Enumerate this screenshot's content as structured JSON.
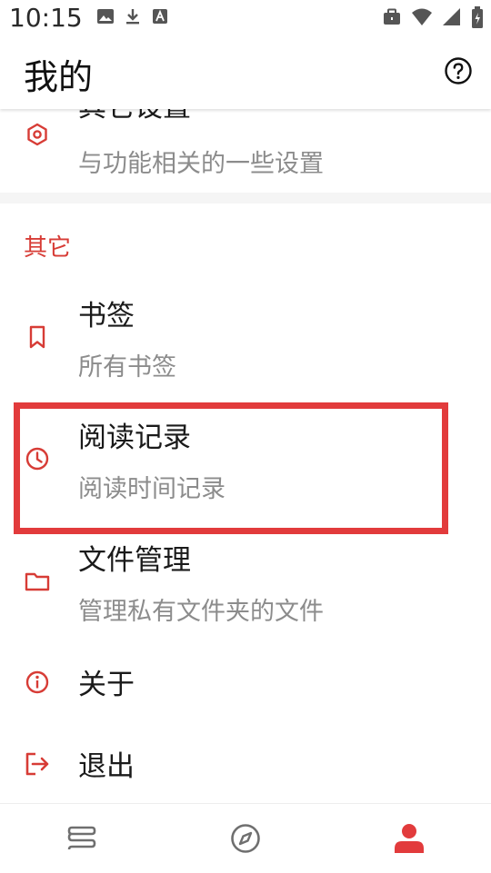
{
  "status_bar": {
    "time": "10:15",
    "icons_left": [
      "image-icon",
      "download-icon",
      "a-icon"
    ],
    "icons_right": [
      "briefcase-icon",
      "wifi-icon",
      "signal-icon",
      "battery-icon"
    ]
  },
  "app_bar": {
    "title": "我的",
    "help_icon": "help-circle-icon"
  },
  "items": {
    "other_settings": {
      "title": "其它设置",
      "subtitle": "与功能相关的一些设置",
      "icon": "settings-icon"
    },
    "bookmarks": {
      "title": "书签",
      "subtitle": "所有书签",
      "icon": "bookmark-icon"
    },
    "reading_history": {
      "title": "阅读记录",
      "subtitle": "阅读时间记录",
      "icon": "clock-icon"
    },
    "file_management": {
      "title": "文件管理",
      "subtitle": "管理私有文件夹的文件",
      "icon": "folder-icon"
    },
    "about": {
      "title": "关于",
      "icon": "info-icon"
    },
    "logout": {
      "title": "退出",
      "icon": "logout-icon"
    }
  },
  "section_other": {
    "label": "其它"
  },
  "bottom_nav": {
    "tabs": [
      "bookshelf-icon",
      "explore-icon",
      "profile-icon"
    ],
    "active": "profile-icon"
  },
  "colors": {
    "accent": "#d73c36",
    "highlight_border": "#e23b3c",
    "subtitle": "#8c8c8c",
    "nav_inactive": "#6f6f6f"
  }
}
